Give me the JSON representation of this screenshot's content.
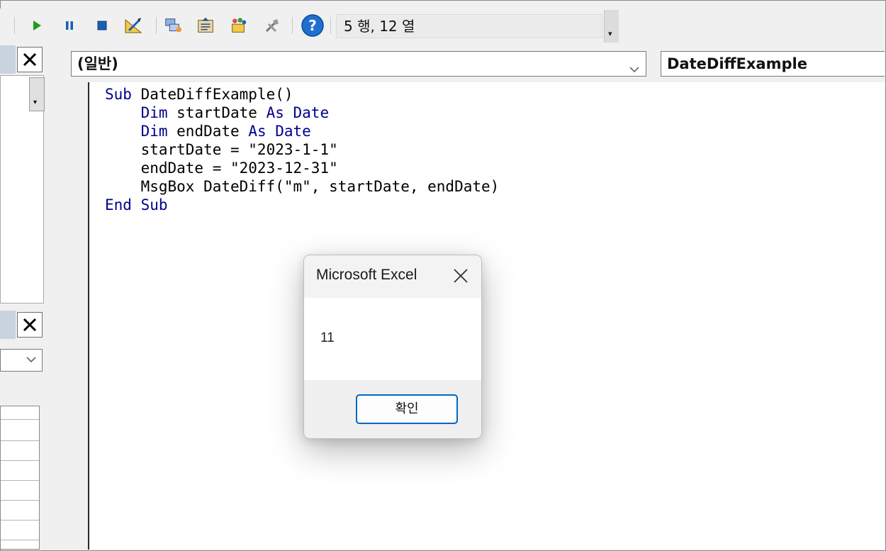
{
  "toolbar": {
    "status_text": "5 행, 12 열",
    "icons": [
      "run-icon",
      "pause-icon",
      "stop-icon",
      "design-mode-icon",
      "project-explorer-icon",
      "properties-icon",
      "object-browser-icon",
      "toolbox-icon",
      "help-icon"
    ],
    "colors": {
      "run": "#1e9c1e",
      "pause": "#1a5fb4",
      "stop": "#1a5fb4",
      "help": "#1f6fd1"
    }
  },
  "code_window": {
    "object_combo": "(일반)",
    "procedure_combo": "DateDiffExample",
    "lines": [
      [
        {
          "t": "Sub ",
          "k": 1
        },
        {
          "t": "DateDiffExample()",
          "k": 0
        }
      ],
      [
        {
          "t": "    ",
          "k": 0
        },
        {
          "t": "Dim ",
          "k": 1
        },
        {
          "t": "startDate ",
          "k": 0
        },
        {
          "t": "As Date",
          "k": 1
        }
      ],
      [
        {
          "t": "    ",
          "k": 0
        },
        {
          "t": "Dim ",
          "k": 1
        },
        {
          "t": "endDate ",
          "k": 0
        },
        {
          "t": "As Date",
          "k": 1
        }
      ],
      [
        {
          "t": "    startDate = \"2023-1-1\"",
          "k": 0
        }
      ],
      [
        {
          "t": "    endDate = \"2023-12-31\"",
          "k": 0
        }
      ],
      [
        {
          "t": "    MsgBox DateDiff(\"m\", startDate, endDate)",
          "k": 0
        }
      ],
      [
        {
          "t": "End Sub",
          "k": 1
        }
      ]
    ],
    "keyword_color": "#00008b"
  },
  "msgbox": {
    "title": "Microsoft Excel",
    "message": "11",
    "ok_label": "확인",
    "accent": "#0067c0"
  }
}
